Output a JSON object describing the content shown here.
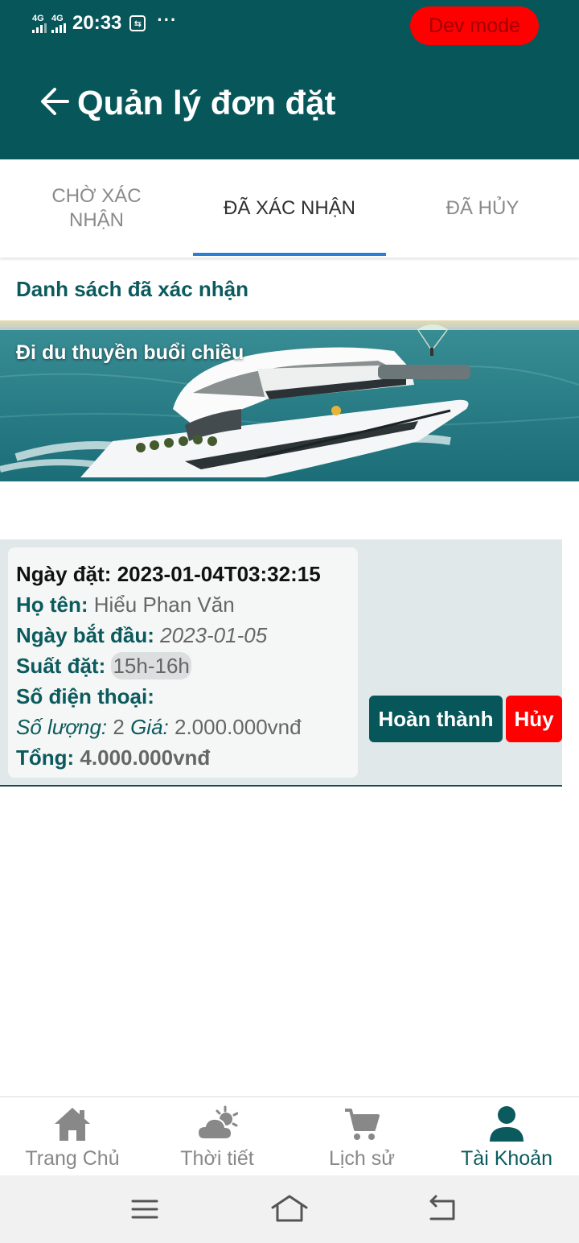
{
  "status_bar": {
    "signal1": "4G",
    "signal2": "4G",
    "time": "20:33",
    "app_icon": "teamviewer-icon",
    "dots": "···",
    "dev_badge": "Dev mode"
  },
  "header": {
    "title": "Quản lý đơn đặt",
    "back_icon": "arrow-left-icon"
  },
  "tabs": [
    {
      "label": "Chờ xác nhận",
      "active": false
    },
    {
      "label": "Đã xác nhận",
      "active": true
    },
    {
      "label": "Đã hủy",
      "active": false
    }
  ],
  "section_title": "Danh sách đã xác nhận",
  "tour": {
    "title": "Đi du thuyền buổi chiều"
  },
  "order": {
    "booked_label": "Ngày đặt:",
    "booked_value": "2023-01-04T03:32:15",
    "name_label": "Họ tên:",
    "name_value": "Hiểu Phan Văn",
    "start_label": "Ngày bắt đầu:",
    "start_value": "2023-01-05",
    "slot_label": "Suất đặt:",
    "slot_value": "15h-16h",
    "phone_label": "Số điện thoại:",
    "phone_value": "",
    "qty_label": "Số lượng:",
    "qty_value": "2",
    "price_label": "Giá:",
    "price_value": "2.000.000vnđ",
    "total_label": "Tổng:",
    "total_value": "4.000.000vnđ"
  },
  "actions": {
    "complete": "Hoàn thành",
    "cancel": "Hủy"
  },
  "bottom_nav": [
    {
      "label": "Trang Chủ",
      "icon": "home-icon",
      "active": false
    },
    {
      "label": "Thời tiết",
      "icon": "weather-icon",
      "active": false
    },
    {
      "label": "Lịch sử",
      "icon": "cart-icon",
      "active": false
    },
    {
      "label": "Tài Khoản",
      "icon": "user-icon",
      "active": true
    }
  ],
  "colors": {
    "primary": "#075659",
    "accent_blue": "#2a7fd4",
    "danger": "#ff0000",
    "row_bg": "#e1e8e9"
  }
}
